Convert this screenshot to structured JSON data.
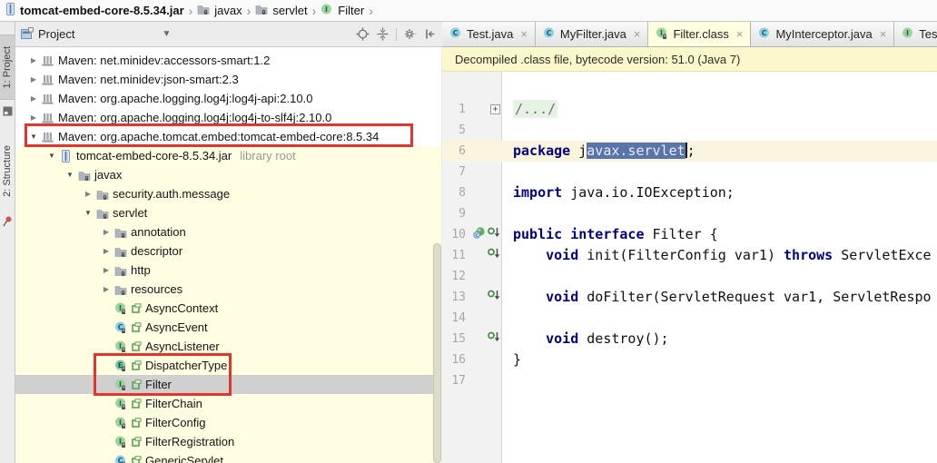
{
  "colors": {
    "file_color_yellow": "#FFFEE3",
    "banner_yellow": "#FCF8CC",
    "selection_blue": "#5974AB",
    "keyword_navy": "#000080",
    "current_line": "#FBF5DD",
    "annotation_red": "#E3352C",
    "tree_selection_gray": "#D0D0D0",
    "interface_icon_green": "#9ED49B",
    "class_icon_teal": "#8FD0DE"
  },
  "breadcrumb": {
    "items": [
      {
        "label": "tomcat-embed-core-8.5.34.jar",
        "icon": "jar"
      },
      {
        "label": "javax",
        "icon": "folder"
      },
      {
        "label": "servlet",
        "icon": "folder"
      },
      {
        "label": "Filter",
        "icon": "interface"
      }
    ]
  },
  "left_toolbar": {
    "items": [
      {
        "label": "1: Project",
        "active": true
      },
      {
        "label": "2: Structure",
        "active": false
      }
    ]
  },
  "project_panel": {
    "title": "Project",
    "actions": [
      "locate",
      "collapse-all",
      "gear",
      "hide-panel"
    ],
    "tree": [
      {
        "indent": 1,
        "arrow": "c",
        "icon": "library",
        "label": "Maven: net.minidev:accessors-smart:1.2"
      },
      {
        "indent": 1,
        "arrow": "c",
        "icon": "library",
        "label": "Maven: net.minidev:json-smart:2.3"
      },
      {
        "indent": 1,
        "arrow": "c",
        "icon": "library",
        "label": "Maven: org.apache.logging.log4j:log4j-api:2.10.0"
      },
      {
        "indent": 1,
        "arrow": "c",
        "icon": "library",
        "label": "Maven: org.apache.logging.log4j:log4j-to-slf4j:2.10.0"
      },
      {
        "indent": 1,
        "arrow": "e",
        "icon": "library",
        "label": "Maven: org.apache.tomcat.embed:tomcat-embed-core:8.5.34"
      },
      {
        "indent": 2,
        "arrow": "e",
        "icon": "jar",
        "label": "tomcat-embed-core-8.5.34.jar",
        "suffix": "library root",
        "yellow": true
      },
      {
        "indent": 3,
        "arrow": "e",
        "icon": "folder",
        "label": "javax",
        "yellow": true
      },
      {
        "indent": 4,
        "arrow": "c",
        "icon": "folder",
        "label": "security.auth.message",
        "yellow": true
      },
      {
        "indent": 4,
        "arrow": "e",
        "icon": "folder",
        "label": "servlet",
        "yellow": true
      },
      {
        "indent": 5,
        "arrow": "c",
        "icon": "folder",
        "label": "annotation",
        "yellow": true
      },
      {
        "indent": 5,
        "arrow": "c",
        "icon": "folder",
        "label": "descriptor",
        "yellow": true
      },
      {
        "indent": 5,
        "arrow": "c",
        "icon": "folder",
        "label": "http",
        "yellow": true
      },
      {
        "indent": 5,
        "arrow": "c",
        "icon": "folder",
        "label": "resources",
        "yellow": true
      },
      {
        "indent": 5,
        "arrow": null,
        "icon": "interface",
        "marker": true,
        "label": "AsyncContext",
        "yellow": true
      },
      {
        "indent": 5,
        "arrow": null,
        "icon": "class",
        "marker": true,
        "label": "AsyncEvent",
        "yellow": true
      },
      {
        "indent": 5,
        "arrow": null,
        "icon": "interface",
        "marker": true,
        "label": "AsyncListener",
        "yellow": true
      },
      {
        "indent": 5,
        "arrow": null,
        "icon": "enum",
        "marker": true,
        "label": "DispatcherType",
        "yellow": true
      },
      {
        "indent": 5,
        "arrow": null,
        "icon": "interface",
        "marker": true,
        "label": "Filter",
        "yellow": true,
        "selected": true
      },
      {
        "indent": 5,
        "arrow": null,
        "icon": "interface",
        "marker": true,
        "label": "FilterChain",
        "yellow": true
      },
      {
        "indent": 5,
        "arrow": null,
        "icon": "interface",
        "marker": true,
        "label": "FilterConfig",
        "yellow": true
      },
      {
        "indent": 5,
        "arrow": null,
        "icon": "interface",
        "marker": true,
        "label": "FilterRegistration",
        "yellow": true
      },
      {
        "indent": 5,
        "arrow": null,
        "icon": "class",
        "marker": true,
        "label": "GenericServlet",
        "yellow": true
      }
    ]
  },
  "editor": {
    "tabs": [
      {
        "label": "Test.java",
        "icon": "class",
        "closable": true,
        "active": false
      },
      {
        "label": "MyFilter.java",
        "icon": "class",
        "closable": true,
        "active": false
      },
      {
        "label": "Filter.class",
        "icon": "interface-lock",
        "closable": true,
        "active": true
      },
      {
        "label": "MyInterceptor.java",
        "icon": "class",
        "closable": true,
        "active": false
      },
      {
        "label": "TestS",
        "icon": "interface",
        "closable": false,
        "active": false
      }
    ],
    "banner": "Decompiled .class file, bytecode version: 51.0 (Java 7)",
    "code": {
      "lines": [
        {
          "num": "1",
          "fold": true,
          "segments": [
            {
              "t": "/.../",
              "s": "fold"
            }
          ]
        },
        {
          "num": "5",
          "segments": []
        },
        {
          "num": "6",
          "current": true,
          "segments": [
            {
              "t": "package ",
              "s": "k"
            },
            {
              "t": "j",
              "s": "p"
            },
            {
              "t": "avax.servlet",
              "s": "sel"
            },
            {
              "t": "",
              "s": "caret"
            },
            {
              "t": ";",
              "s": "p"
            }
          ]
        },
        {
          "num": "7",
          "segments": []
        },
        {
          "num": "8",
          "segments": [
            {
              "t": "import ",
              "s": "k"
            },
            {
              "t": "java.io.IOException;",
              "s": "p"
            }
          ]
        },
        {
          "num": "9",
          "segments": []
        },
        {
          "num": "10",
          "gutter": [
            "ball-c",
            "impl"
          ],
          "segments": [
            {
              "t": "public interface ",
              "s": "k"
            },
            {
              "t": "Filter {",
              "s": "p"
            }
          ]
        },
        {
          "num": "11",
          "gutter": [
            "impl"
          ],
          "segments": [
            {
              "t": "    ",
              "s": "p"
            },
            {
              "t": "void ",
              "s": "k"
            },
            {
              "t": "init(FilterConfig var1) ",
              "s": "p"
            },
            {
              "t": "throws ",
              "s": "k"
            },
            {
              "t": "ServletExce",
              "s": "p"
            }
          ]
        },
        {
          "num": "12",
          "segments": []
        },
        {
          "num": "13",
          "gutter": [
            "impl"
          ],
          "segments": [
            {
              "t": "    ",
              "s": "p"
            },
            {
              "t": "void ",
              "s": "k"
            },
            {
              "t": "doFilter(ServletRequest var1, ServletRespo",
              "s": "p"
            }
          ]
        },
        {
          "num": "14",
          "segments": []
        },
        {
          "num": "15",
          "gutter": [
            "impl"
          ],
          "segments": [
            {
              "t": "    ",
              "s": "p"
            },
            {
              "t": "void ",
              "s": "k"
            },
            {
              "t": "destroy();",
              "s": "p"
            }
          ]
        },
        {
          "num": "16",
          "segments": [
            {
              "t": "}",
              "s": "p"
            }
          ]
        },
        {
          "num": "17",
          "segments": []
        }
      ]
    }
  }
}
